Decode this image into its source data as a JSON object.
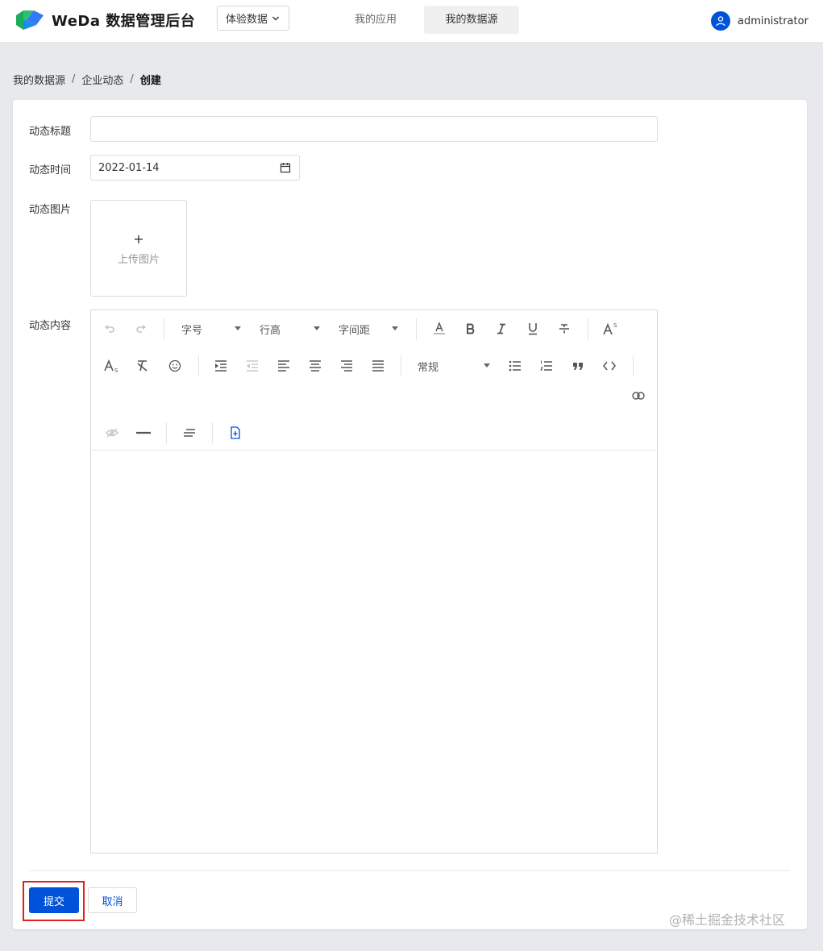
{
  "header": {
    "brand": "WeDa 数据管理后台",
    "env_select": "体验数据",
    "tabs": [
      {
        "label": "我的应用",
        "active": false
      },
      {
        "label": "我的数据源",
        "active": true
      }
    ],
    "username": "administrator"
  },
  "breadcrumb": {
    "items": [
      "我的数据源",
      "企业动态",
      "创建"
    ],
    "separator": "/"
  },
  "form": {
    "title_label": "动态标题",
    "title_value": "",
    "time_label": "动态时间",
    "time_value": "2022-01-14",
    "image_label": "动态图片",
    "upload_plus": "+",
    "upload_text": "上传图片",
    "content_label": "动态内容"
  },
  "editor": {
    "font_size": "字号",
    "line_height": "行高",
    "letter_spacing": "字间距",
    "paragraph_style": "常规",
    "content": ""
  },
  "actions": {
    "submit": "提交",
    "cancel": "取消"
  },
  "watermark": "@稀土掘金技术社区",
  "colors": {
    "primary": "#0052d9",
    "highlight": "#e02020",
    "background": "#e7e9ec"
  }
}
